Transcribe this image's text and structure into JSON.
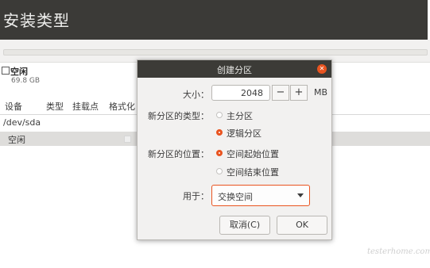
{
  "page": {
    "title": "安装类型"
  },
  "partition_list": {
    "free_label": "空闲",
    "free_size": "69.8 GB",
    "columns": [
      "设备",
      "类型",
      "挂载点",
      "格式化"
    ],
    "device": "/dev/sda",
    "selected_row": "空闲"
  },
  "dialog": {
    "title": "创建分区",
    "size_label": "大小：",
    "size_value": "2048",
    "minus": "−",
    "plus": "+",
    "unit": "MB",
    "type_label": "新分区的类型：",
    "type_options": [
      "主分区",
      "逻辑分区"
    ],
    "type_selected": "逻辑分区",
    "location_label": "新分区的位置：",
    "location_options": [
      "空间起始位置",
      "空间结束位置"
    ],
    "location_selected": "空间起始位置",
    "use_label": "用于：",
    "use_value": "交换空间",
    "cancel": "取消(C)",
    "ok": "OK"
  },
  "watermark": "testerhome.com",
  "colors": {
    "accent": "#e95420",
    "header_bg": "#3b3a37",
    "dialog_bg": "#f2f1f0"
  }
}
